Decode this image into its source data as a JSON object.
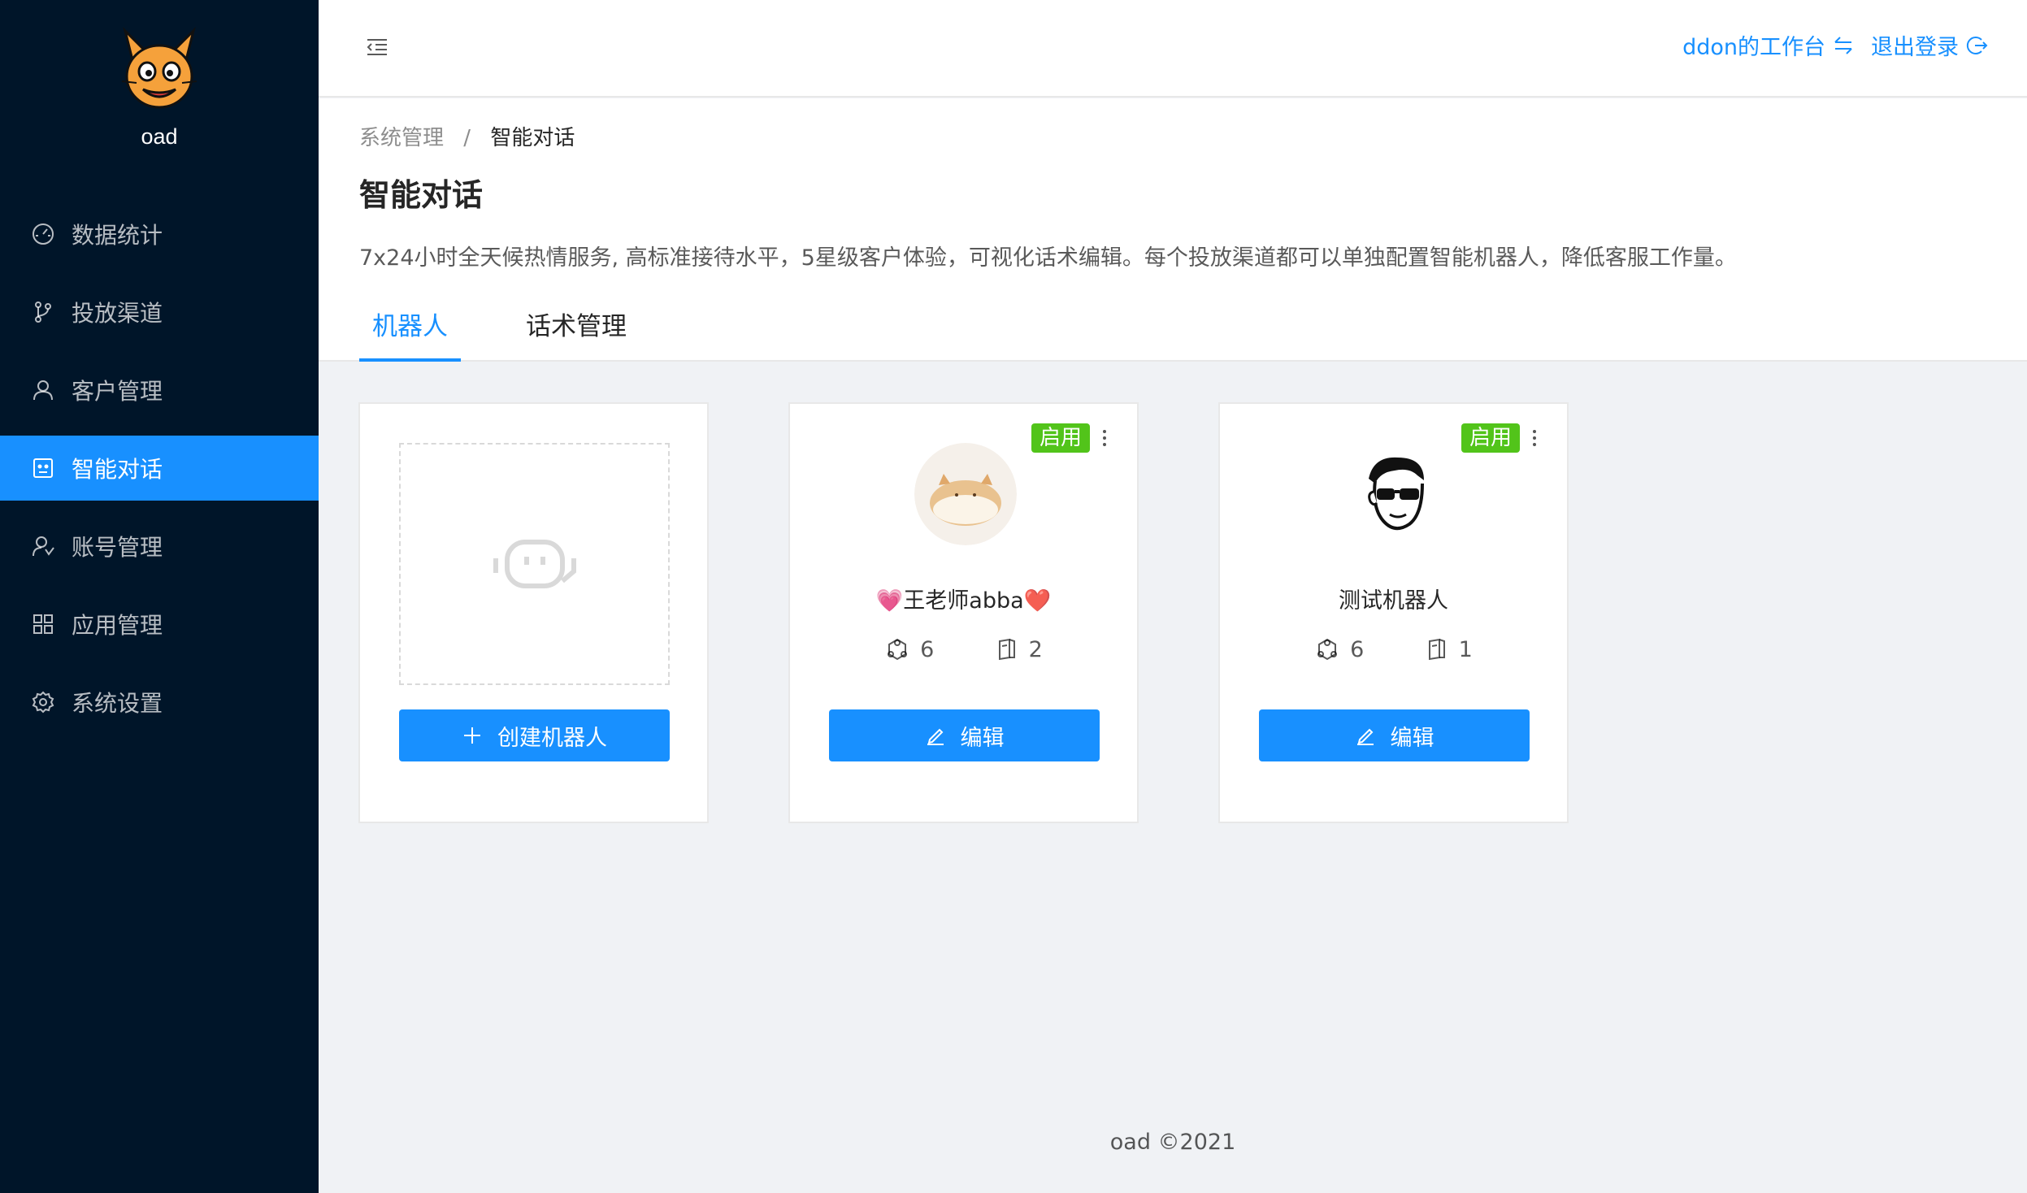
{
  "app": {
    "logo_text": "oad"
  },
  "sidebar": {
    "items": [
      {
        "label": "数据统计",
        "icon": "dashboard-icon",
        "active": false
      },
      {
        "label": "投放渠道",
        "icon": "branch-icon",
        "active": false
      },
      {
        "label": "客户管理",
        "icon": "user-icon",
        "active": false
      },
      {
        "label": "智能对话",
        "icon": "robot-icon",
        "active": true
      },
      {
        "label": "账号管理",
        "icon": "team-icon",
        "active": false
      },
      {
        "label": "应用管理",
        "icon": "appstore-icon",
        "active": false
      },
      {
        "label": "系统设置",
        "icon": "setting-icon",
        "active": false
      }
    ]
  },
  "header": {
    "workspace_label": "ddon的工作台",
    "logout_label": "退出登录"
  },
  "breadcrumb": {
    "parent": "系统管理",
    "separator": "/",
    "current": "智能对话"
  },
  "page": {
    "title": "智能对话",
    "description": "7x24小时全天候热情服务, 高标准接待水平，5星级客户体验，可视化话术编辑。每个投放渠道都可以单独配置智能机器人，降低客服工作量。"
  },
  "tabs": [
    {
      "label": "机器人",
      "active": true
    },
    {
      "label": "话术管理",
      "active": false
    }
  ],
  "create_card": {
    "button_label": "创建机器人"
  },
  "bots": [
    {
      "name": "💗王老师abba❤️",
      "status": "启用",
      "stat1": "6",
      "stat2": "2",
      "button_label": "编辑"
    },
    {
      "name": "测试机器人",
      "status": "启用",
      "stat1": "6",
      "stat2": "1",
      "button_label": "编辑"
    }
  ],
  "footer": {
    "text": "oad ©2021"
  },
  "colors": {
    "primary": "#1890ff",
    "sidebar_bg": "#001529",
    "success": "#52c41a"
  }
}
